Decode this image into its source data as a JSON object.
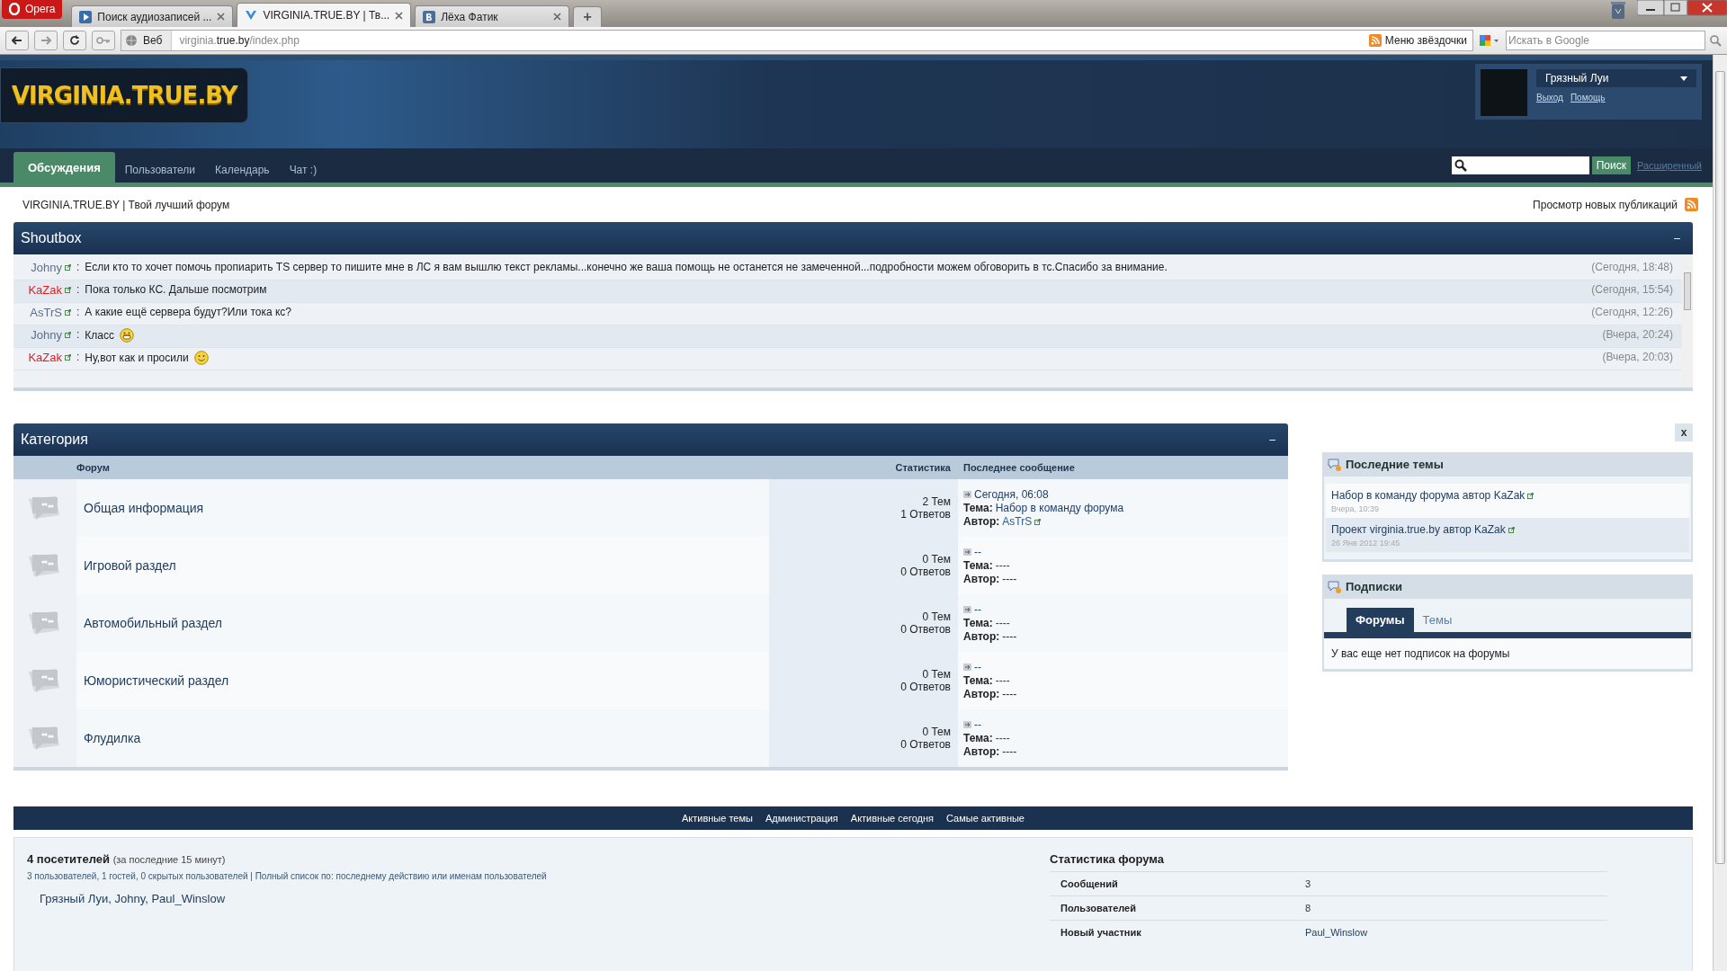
{
  "browser": {
    "menu_label": "Opera",
    "tabs": [
      {
        "title": "Поиск аудиозаписей ...",
        "selected": false,
        "kind": "play"
      },
      {
        "title": "VIRGINIA.TRUE.BY | Тв...",
        "selected": true,
        "kind": "v"
      },
      {
        "title": "Лёха Фатик",
        "selected": false,
        "kind": "vk"
      }
    ],
    "new_tab": "+",
    "web_label": "Веб",
    "address": "virginia.**true.by**/index.php",
    "bookmarks": "Меню звёздочки",
    "search_placeholder": "Искать в Google"
  },
  "header": {
    "logo": "VIRGINIA.TRUE.BY",
    "user": {
      "name": "Грязный Луи",
      "links": [
        "Выход",
        "Помощь"
      ]
    },
    "nav": [
      {
        "label": "Обсуждения",
        "selected": true
      },
      {
        "label": "Пользователи",
        "selected": false
      },
      {
        "label": "Календарь",
        "selected": false
      },
      {
        "label": "Чат :)",
        "selected": false
      }
    ],
    "search_button": "Поиск",
    "advanced_link": "Расширенный"
  },
  "breadcrumb": "VIRGINIA.TRUE.BY | Твой лучший форум",
  "new_posts_link": "Просмотр новых публикаций",
  "shoutbox": {
    "title": "Shoutbox",
    "collapse": "–",
    "messages": [
      {
        "author": "Johny",
        "color": "#5a6f8a",
        "colon": ":",
        "text": "Если кто то хочет помочь пропиарить TS сервер то пишите мне в ЛС я вам вышлю текст рекламы...конечно же ваша помощь не останется не замеченной...подробности можем обговорить в тс.Спасибо за внимание.",
        "kind": "plain",
        "time": "(Сегодня, 18:48)"
      },
      {
        "author": "KaZak",
        "color": "#e02020",
        "colon": ":",
        "text": "Пока только КС. Дальше посмотрим",
        "kind": "plain",
        "time": "(Сегодня, 15:54)"
      },
      {
        "author": "AsTrS",
        "color": "#5a6f8a",
        "colon": ":",
        "text": "А какие ещё сервера будут?Или тока кс?",
        "kind": "plain",
        "time": "(Сегодня, 12:26)"
      },
      {
        "author": "Johny",
        "color": "#5a6f8a",
        "colon": ":",
        "text": "Класс",
        "kind": "grin",
        "time": "(Вчера, 20:24)"
      },
      {
        "author": "KaZak",
        "color": "#e02020",
        "colon": ":",
        "text": "Ну,вот как и просили",
        "kind": "smile",
        "time": "(Вчера, 20:03)"
      }
    ]
  },
  "category": {
    "title": "Категория",
    "collapse": "–",
    "columns": [
      "Форум",
      "Статистика",
      "Последнее сообщение"
    ],
    "rows": [
      {
        "name": "Общая информация",
        "topics": "2 Тем",
        "replies": "1 Ответов",
        "last_date": "Сегодня, 06:08",
        "topic_label": "Тема:",
        "topic": "Набор в команду форума",
        "author_label": "Автор:",
        "author": "AsTrS",
        "author_is_user": true
      },
      {
        "name": "Игровой раздел",
        "topics": "0 Тем",
        "replies": "0 Ответов",
        "last_date": "--",
        "topic_label": "Тема:",
        "topic": "----",
        "author_label": "Автор:",
        "author": "----",
        "author_is_user": false
      },
      {
        "name": "Автомобильный раздел",
        "topics": "0 Тем",
        "replies": "0 Ответов",
        "last_date": "--",
        "topic_label": "Тема:",
        "topic": "----",
        "author_label": "Автор:",
        "author": "----",
        "author_is_user": false
      },
      {
        "name": "Юмористический раздел",
        "topics": "0 Тем",
        "replies": "0 Ответов",
        "last_date": "--",
        "topic_label": "Тема:",
        "topic": "----",
        "author_label": "Автор:",
        "author": "----",
        "author_is_user": false
      },
      {
        "name": "Флудилка",
        "topics": "0 Тем",
        "replies": "0 Ответов",
        "last_date": "--",
        "topic_label": "Тема:",
        "topic": "----",
        "author_label": "Автор:",
        "author": "----",
        "author_is_user": false
      }
    ]
  },
  "sidebar": {
    "close": "x",
    "latest": {
      "title": "Последние темы",
      "items": [
        {
          "topic": "Набор в команду форума",
          "by": "автор",
          "author": "KaZak",
          "date": "Вчера, 10:39"
        },
        {
          "topic": "Проект virginia.true.by",
          "by": "автор",
          "author": "KaZak",
          "date": "26 Янв 2012 19:45"
        }
      ]
    },
    "subscriptions": {
      "title": "Подписки",
      "tabs": [
        {
          "label": "Форумы",
          "selected": true
        },
        {
          "label": "Темы",
          "selected": false
        }
      ],
      "message": "У вас еще нет подписок на форумы"
    }
  },
  "footer_links": [
    "Активные темы",
    "Администрация",
    "Активные сегодня",
    "Самые активные"
  ],
  "online": {
    "title": "4 посетителей",
    "note": "(за последние 15 минут)",
    "summary": "3 пользователей, 1 гостей, 0 скрытых пользователей | Полный список по: последнему действию или именам пользователей",
    "names": "Грязный Луи, Johny, Paul_Winslow"
  },
  "stats": {
    "title": "Статистика форума",
    "rows": [
      {
        "label": "Сообщений",
        "value": "3"
      },
      {
        "label": "Пользователей",
        "value": "8"
      },
      {
        "label": "Новый участник",
        "value": "Paul_Winslow"
      }
    ]
  }
}
